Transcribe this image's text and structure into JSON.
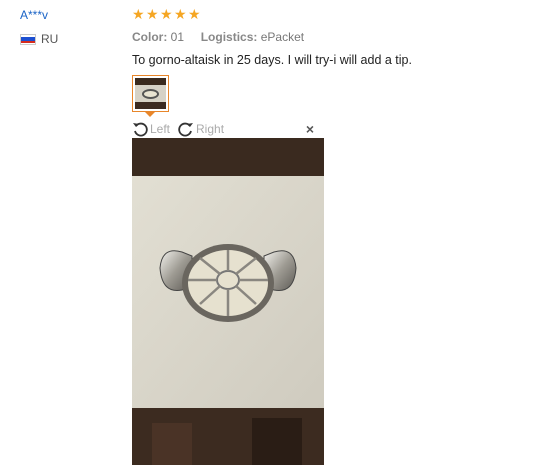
{
  "user": {
    "name": "A***v",
    "country": "RU"
  },
  "review": {
    "rating": 5,
    "color_label": "Color:",
    "color_value": "01",
    "logistics_label": "Logistics:",
    "logistics_value": "ePacket",
    "text": "To gorno-altaisk in 25 days. I will try-i will add a tip."
  },
  "viewer": {
    "rotate_left_label": "Left",
    "rotate_right_label": "Right",
    "close_label": "×"
  },
  "colors": {
    "star": "#f5a623",
    "link": "#1a63c6",
    "thumb_border": "#e8862a"
  },
  "icons": [
    "rotate-left-icon",
    "rotate-right-icon",
    "close-icon",
    "star-icon",
    "flag-ru-icon"
  ]
}
